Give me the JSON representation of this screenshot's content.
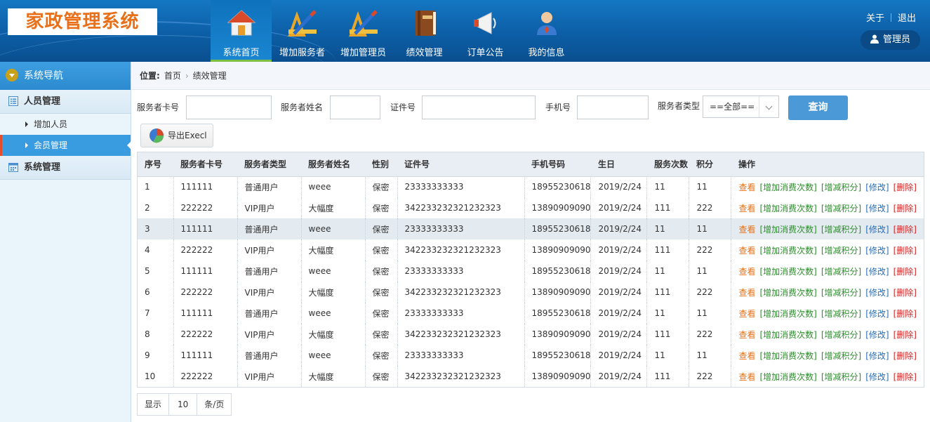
{
  "app": {
    "title": "家政管理系统"
  },
  "nav": [
    {
      "label": "系统首页",
      "icon": "house-icon",
      "active": true
    },
    {
      "label": "增加服务者",
      "icon": "ruler-pencil-icon"
    },
    {
      "label": "增加管理员",
      "icon": "ruler-pencil-icon"
    },
    {
      "label": "绩效管理",
      "icon": "book-icon"
    },
    {
      "label": "订单公告",
      "icon": "megaphone-icon"
    },
    {
      "label": "我的信息",
      "icon": "user-icon"
    }
  ],
  "top_links": {
    "about": "关于",
    "logout": "退出"
  },
  "user": {
    "role": "管理员"
  },
  "sidebar": {
    "title": "系统导航",
    "groups": [
      {
        "label": "人员管理",
        "items": [
          {
            "label": "增加人员"
          },
          {
            "label": "会员管理",
            "active": true
          }
        ]
      },
      {
        "label": "系统管理"
      }
    ]
  },
  "breadcrumb": {
    "prefix": "位置:",
    "items": [
      "首页",
      "绩效管理"
    ]
  },
  "filters": {
    "card_label": "服务者卡号",
    "card_value": "",
    "name_label": "服务者姓名",
    "name_value": "",
    "id_label": "证件号",
    "id_value": "",
    "phone_label": "手机号",
    "phone_value": "",
    "type_label": "服务者类型",
    "type_value": "==全部==",
    "query": "查询",
    "export": "导出Execl"
  },
  "table": {
    "headers": [
      "序号",
      "服务者卡号",
      "服务者类型",
      "服务者姓名",
      "性别",
      "证件号",
      "手机号码",
      "生日",
      "服务次数",
      "积分",
      "操作"
    ],
    "actions": {
      "view": "查看",
      "add": "[增加消费次数]",
      "score": "[增减积分]",
      "edit": "[修改]",
      "del": "[删除]"
    },
    "rows": [
      [
        "1",
        "111111",
        "普通用户",
        "weee",
        "保密",
        "23333333333",
        "18955230618",
        "2019/2/24",
        "11",
        "11"
      ],
      [
        "2",
        "222222",
        "VIP用户",
        "大幅度",
        "保密",
        "342233232321232323",
        "13890909090",
        "2019/2/24",
        "111",
        "222"
      ],
      [
        "3",
        "111111",
        "普通用户",
        "weee",
        "保密",
        "23333333333",
        "18955230618",
        "2019/2/24",
        "11",
        "11"
      ],
      [
        "4",
        "222222",
        "VIP用户",
        "大幅度",
        "保密",
        "342233232321232323",
        "13890909090",
        "2019/2/24",
        "111",
        "222"
      ],
      [
        "5",
        "111111",
        "普通用户",
        "weee",
        "保密",
        "23333333333",
        "18955230618",
        "2019/2/24",
        "11",
        "11"
      ],
      [
        "6",
        "222222",
        "VIP用户",
        "大幅度",
        "保密",
        "342233232321232323",
        "13890909090",
        "2019/2/24",
        "111",
        "222"
      ],
      [
        "7",
        "111111",
        "普通用户",
        "weee",
        "保密",
        "23333333333",
        "18955230618",
        "2019/2/24",
        "11",
        "11"
      ],
      [
        "8",
        "222222",
        "VIP用户",
        "大幅度",
        "保密",
        "342233232321232323",
        "13890909090",
        "2019/2/24",
        "111",
        "222"
      ],
      [
        "9",
        "111111",
        "普通用户",
        "weee",
        "保密",
        "23333333333",
        "18955230618",
        "2019/2/24",
        "11",
        "11"
      ],
      [
        "10",
        "222222",
        "VIP用户",
        "大幅度",
        "保密",
        "342233232321232323",
        "13890909090",
        "2019/2/24",
        "111",
        "222"
      ]
    ],
    "highlight_row": 3
  },
  "pager": {
    "show": "显示",
    "page_size": "10",
    "unit": "条/页"
  }
}
